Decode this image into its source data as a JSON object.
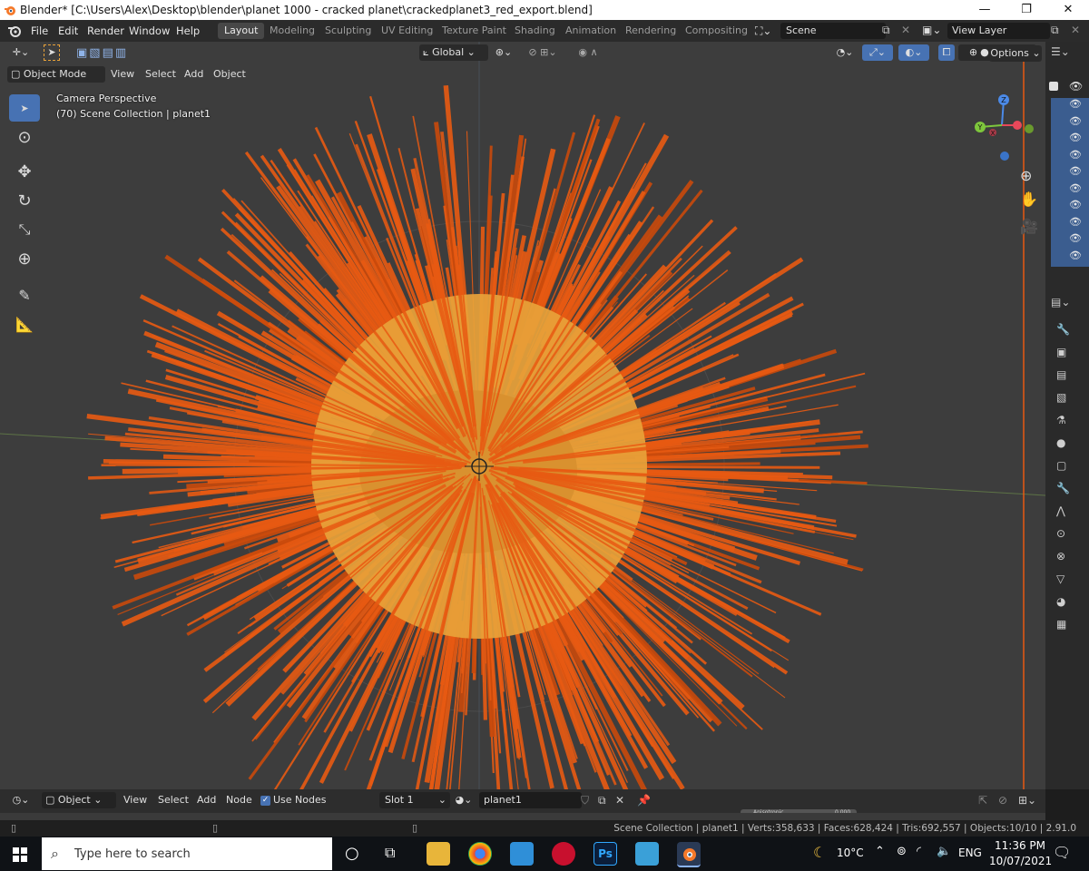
{
  "window": {
    "title": "Blender* [C:\\Users\\Alex\\Desktop\\blender\\planet 1000 - cracked planet\\crackedplanet3_red_export.blend]",
    "controls": [
      "—",
      "❐",
      "✕"
    ]
  },
  "menu": {
    "items": [
      "File",
      "Edit",
      "Render",
      "Window",
      "Help"
    ],
    "workspaces": [
      "Layout",
      "Modeling",
      "Sculpting",
      "UV Editing",
      "Texture Paint",
      "Shading",
      "Animation",
      "Rendering",
      "Compositing"
    ],
    "active_workspace": "Layout",
    "scene_label": "Scene",
    "view_layer_label": "View Layer"
  },
  "viewport": {
    "mode": "Object Mode",
    "menus": [
      "View",
      "Select",
      "Add",
      "Object"
    ],
    "transform_orientation": "Global",
    "options_label": "Options",
    "overlay_line1": "Camera Perspective",
    "overlay_line2": "(70) Scene Collection | planet1",
    "gizmo": {
      "x": "X",
      "y": "Y",
      "z": "Z"
    }
  },
  "shader_editor": {
    "object_label": "Object",
    "menus": [
      "View",
      "Select",
      "Add",
      "Node"
    ],
    "use_nodes_label": "Use Nodes",
    "slot_label": "Slot 1",
    "material_name": "planet1",
    "slider_label": "Anisotropic",
    "slider_value": "0.000"
  },
  "status": {
    "text": "Scene Collection | planet1 | Verts:358,633 | Faces:628,424 | Tris:692,557 | Objects:10/10 | 2.91.0"
  },
  "taskbar": {
    "search_placeholder": "Type here to search",
    "temperature": "10°C",
    "language": "ENG",
    "time": "11:36 PM",
    "date": "10/07/2021"
  },
  "colors": {
    "accent": "#4772b3",
    "orange": "#e85a12",
    "planet": "#e8a23a"
  }
}
